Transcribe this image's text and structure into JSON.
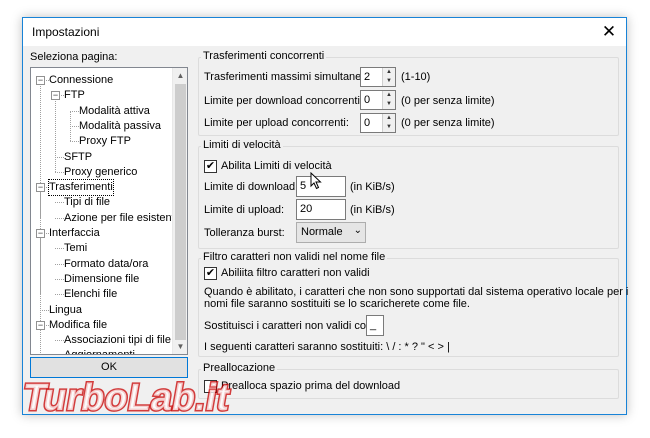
{
  "window": {
    "title": "Impostazioni",
    "close_glyph": "✕"
  },
  "left": {
    "select_page_label": "Seleziona pagina:",
    "tree": [
      "Connessione",
      "FTP",
      "Modalità attiva",
      "Modalità passiva",
      "Proxy FTP",
      "SFTP",
      "Proxy generico",
      "Trasferimenti",
      "Tipi di file",
      "Azione per file esistenti",
      "Interfaccia",
      "Temi",
      "Formato data/ora",
      "Dimensione file",
      "Elenchi file",
      "Lingua",
      "Modifica file",
      "Associazioni tipi di file",
      "Aggiornamenti"
    ],
    "expander_glyph": "−",
    "scroll_up": "▲",
    "scroll_down": "▼",
    "ok_label": "OK"
  },
  "concurrent": {
    "title": "Trasferimenti concorrenti",
    "max_label": "Trasferimenti massimi simultanei:",
    "max_value": "2",
    "max_hint": "(1-10)",
    "download_label": "Limite per download concorrenti:",
    "download_value": "0",
    "download_hint": "(0 per senza limite)",
    "upload_label": "Limite per upload concorrenti:",
    "upload_value": "0",
    "upload_hint": "(0 per senza limite)",
    "spin_up": "▲",
    "spin_down": "▼"
  },
  "speed": {
    "title": "Limiti di velocità",
    "enable_label": "Abilita Limiti di velocità",
    "enabled": true,
    "download_label": "Limite di download:",
    "download_value": "5",
    "download_unit": "(in KiB/s)",
    "upload_label": "Limite di upload:",
    "upload_value": "20",
    "upload_unit": "(in KiB/s)",
    "burst_label": "Tolleranza burst:",
    "burst_value": "Normale",
    "check_glyph": "✔",
    "combo_arrow": "⌄"
  },
  "filter": {
    "title": "Filtro caratteri non validi nel nome file",
    "enable_label": "Abiliita filtro caratteri non validi",
    "enabled": true,
    "description_line1": "Quando è abilitato, i caratteri che non sono supportati dal sistema operativo locale per i",
    "description_line2": "nomi file saranno sostituiti se lo scaricherete come file.",
    "replace_label": "Sostituisci i caratteri non validi con:",
    "replace_value": "_",
    "following_label": "I seguenti caratteri saranno sostituiti: \\ / : * ? \" < > |"
  },
  "prealloc": {
    "title": "Preallocazione",
    "option_label": "Prealloca spazio prima del download",
    "enabled": false
  },
  "watermark": {
    "text": "TurboLab.it"
  }
}
